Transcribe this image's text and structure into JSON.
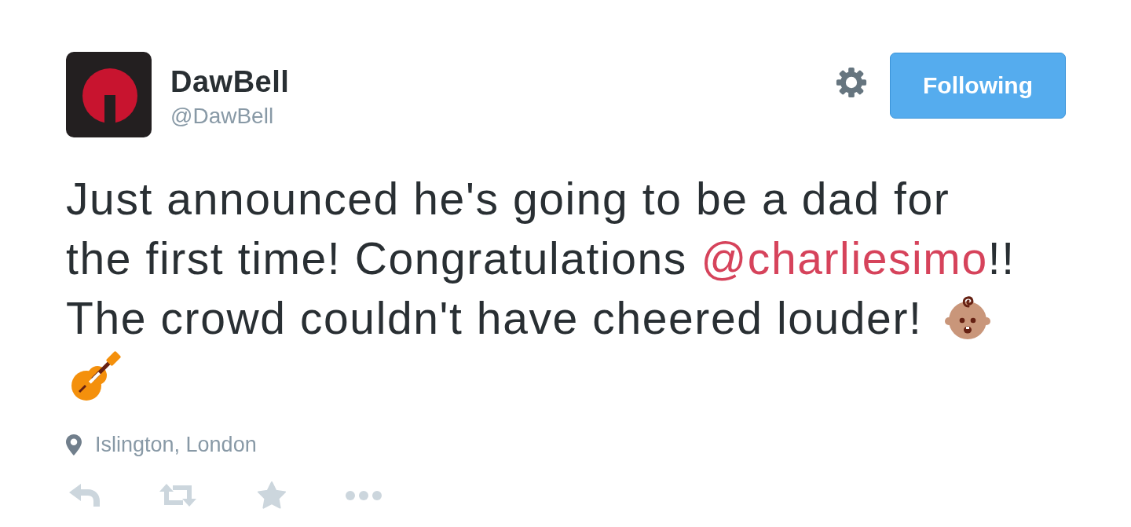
{
  "author": {
    "name": "DawBell",
    "handle": "@DawBell"
  },
  "follow_button": {
    "label": "Following",
    "following": true
  },
  "tweet": {
    "segments": [
      {
        "kind": "text",
        "text": "Just announced he's going to be a dad for the first time! Congratulations "
      },
      {
        "kind": "mention",
        "text": "@charliesimo"
      },
      {
        "kind": "text",
        "text": "!! The crowd couldn't have cheered louder! "
      },
      {
        "kind": "baby"
      },
      {
        "kind": "guitar"
      }
    ]
  },
  "location": {
    "label": "Islington, London"
  }
}
